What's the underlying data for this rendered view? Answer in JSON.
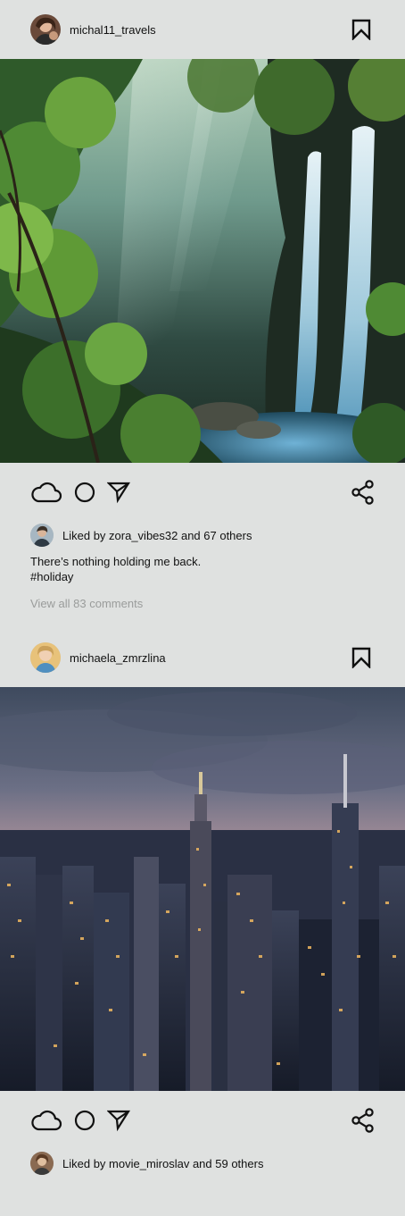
{
  "posts": [
    {
      "username": "michal11_travels",
      "avatar_icon": "user-avatar-photo",
      "liked_by_user": "zora_vibes32",
      "likes_text": "Liked by zora_vibes32 and 67 others",
      "caption": "There’s nothing holding me back.",
      "hashtag": "#holiday",
      "view_comments": "View all 83 comments",
      "photo_subject": "waterfall-forest"
    },
    {
      "username": "michaela_zmrzlina",
      "avatar_icon": "user-avatar-photo",
      "likes_text": "Liked by movie_miroslav and 59 others",
      "photo_subject": "city-skyline-dusk"
    }
  ],
  "icons": {
    "like": "cloud-icon",
    "comment": "circle-icon",
    "send": "send-icon",
    "share": "share-icon",
    "bookmark": "bookmark-icon"
  },
  "colors": {
    "background": "#dfe1e0",
    "muted_text": "#9a9c9b"
  }
}
